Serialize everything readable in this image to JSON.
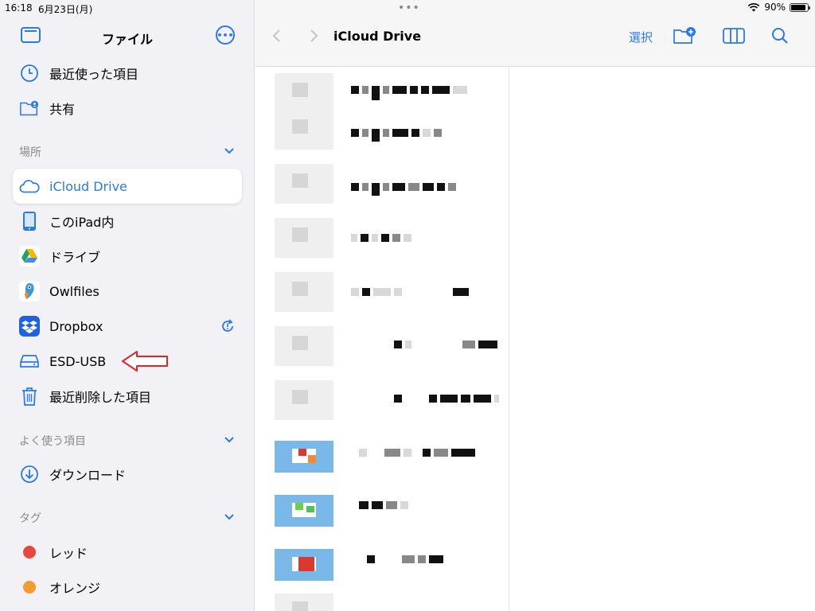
{
  "status": {
    "time": "16:18",
    "date": "6月23日(月)",
    "battery": "90%",
    "battery_level": 0.9
  },
  "sidebar": {
    "title": "ファイル",
    "top_items": [
      {
        "label": "最近使った項目",
        "icon": "clock-icon"
      },
      {
        "label": "共有",
        "icon": "shared-folder-icon"
      }
    ],
    "locations_header": "場所",
    "locations": [
      {
        "label": "iCloud Drive",
        "icon": "cloud-icon",
        "selected": true
      },
      {
        "label": "このiPad内",
        "icon": "ipad-icon"
      },
      {
        "label": "ドライブ",
        "icon": "google-drive-icon"
      },
      {
        "label": "Owlfiles",
        "icon": "owlfiles-icon"
      },
      {
        "label": "Dropbox",
        "icon": "dropbox-icon"
      },
      {
        "label": "ESD-USB",
        "icon": "external-drive-icon"
      },
      {
        "label": "最近削除した項目",
        "icon": "trash-icon"
      }
    ],
    "favorites_header": "よく使う項目",
    "favorites": [
      {
        "label": "ダウンロード",
        "icon": "download-icon"
      }
    ],
    "tags_header": "タグ",
    "tags": [
      {
        "label": "レッド",
        "color": "#e5483f"
      },
      {
        "label": "オレンジ",
        "color": "#f09b33"
      }
    ]
  },
  "toolbar": {
    "title": "iCloud Drive",
    "select_label": "選択"
  },
  "colors": {
    "accent": "#2a7ae2",
    "annotation_arrow": "#d8282a"
  }
}
